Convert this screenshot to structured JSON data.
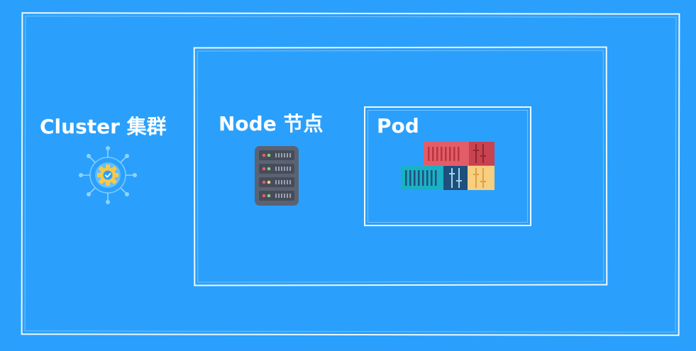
{
  "cluster": {
    "label": "Cluster 集群",
    "icon": "cluster-gear-icon"
  },
  "node": {
    "label": "Node 节点",
    "icon": "server-rack-icon"
  },
  "pod": {
    "label": "Pod",
    "icon": "containers-icon"
  },
  "colors": {
    "background": "#2aa0fc",
    "frame": "#ffffff",
    "text": "#ffffff",
    "server": "#5b6272",
    "container_red": "#e35d68",
    "container_teal": "#1bb1c4",
    "container_navy": "#1f4f7d",
    "container_yellow": "#f7cf7e"
  }
}
